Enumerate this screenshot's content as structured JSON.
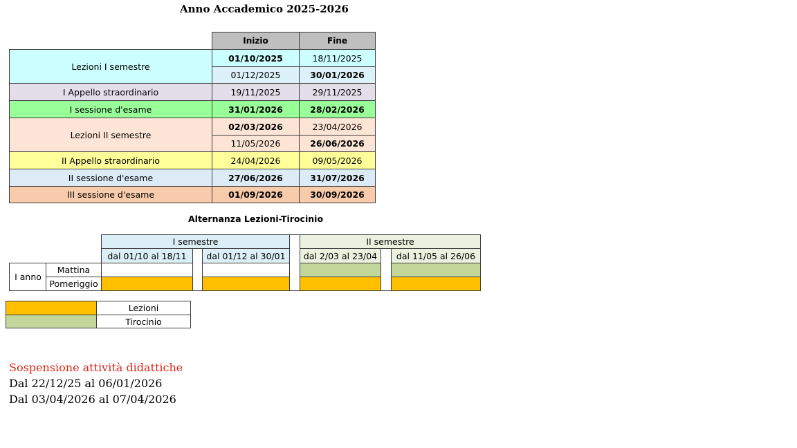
{
  "title": "Anno Accademico 2025-2026",
  "calendar": {
    "headers": {
      "start": "Inizio",
      "end": "Fine"
    },
    "rows": [
      {
        "label": "Lezioni I semestre",
        "start": "01/10/2025",
        "end": "18/11/2025"
      },
      {
        "start": "01/12/2025",
        "end": "30/01/2026"
      },
      {
        "label": "I Appello straordinario",
        "start": "19/11/2025",
        "end": "29/11/2025"
      },
      {
        "label": "I sessione d'esame",
        "start": "31/01/2026",
        "end": "28/02/2026"
      },
      {
        "label": "Lezioni II semestre",
        "start": "02/03/2026",
        "end": "23/04/2026"
      },
      {
        "start": "11/05/2026",
        "end": "26/06/2026"
      },
      {
        "label": "II Appello straordinario",
        "start": "24/04/2026",
        "end": "09/05/2026"
      },
      {
        "label": "II sessione d'esame",
        "start": "27/06/2026",
        "end": "31/07/2026"
      },
      {
        "label": "III sessione d'esame",
        "start": "01/09/2026",
        "end": "30/09/2026"
      }
    ]
  },
  "alternation": {
    "title": "Alternanza Lezioni-Tirocinio",
    "semester1": "I semestre",
    "semester2": "II semestre",
    "periods": [
      "dal 01/10 al 18/11",
      "dal 01/12 al 30/01",
      "dal 2/03 al 23/04",
      "dal 11/05 al 26/06"
    ],
    "year": "I anno",
    "morning": "Mattina",
    "afternoon": "Pomeriggio"
  },
  "legend": {
    "lessons": "Lezioni",
    "internship": "Tirocinio"
  },
  "colors": {
    "lessons": "#ffc000",
    "internship": "#c4d79b",
    "suspension": "#d9261c"
  },
  "suspension": {
    "title": "Sospensione attività didattiche",
    "line1": "Dal 22/12/25 al 06/01/2026",
    "line2": "Dal 03/04/2026 al 07/04/2026"
  }
}
